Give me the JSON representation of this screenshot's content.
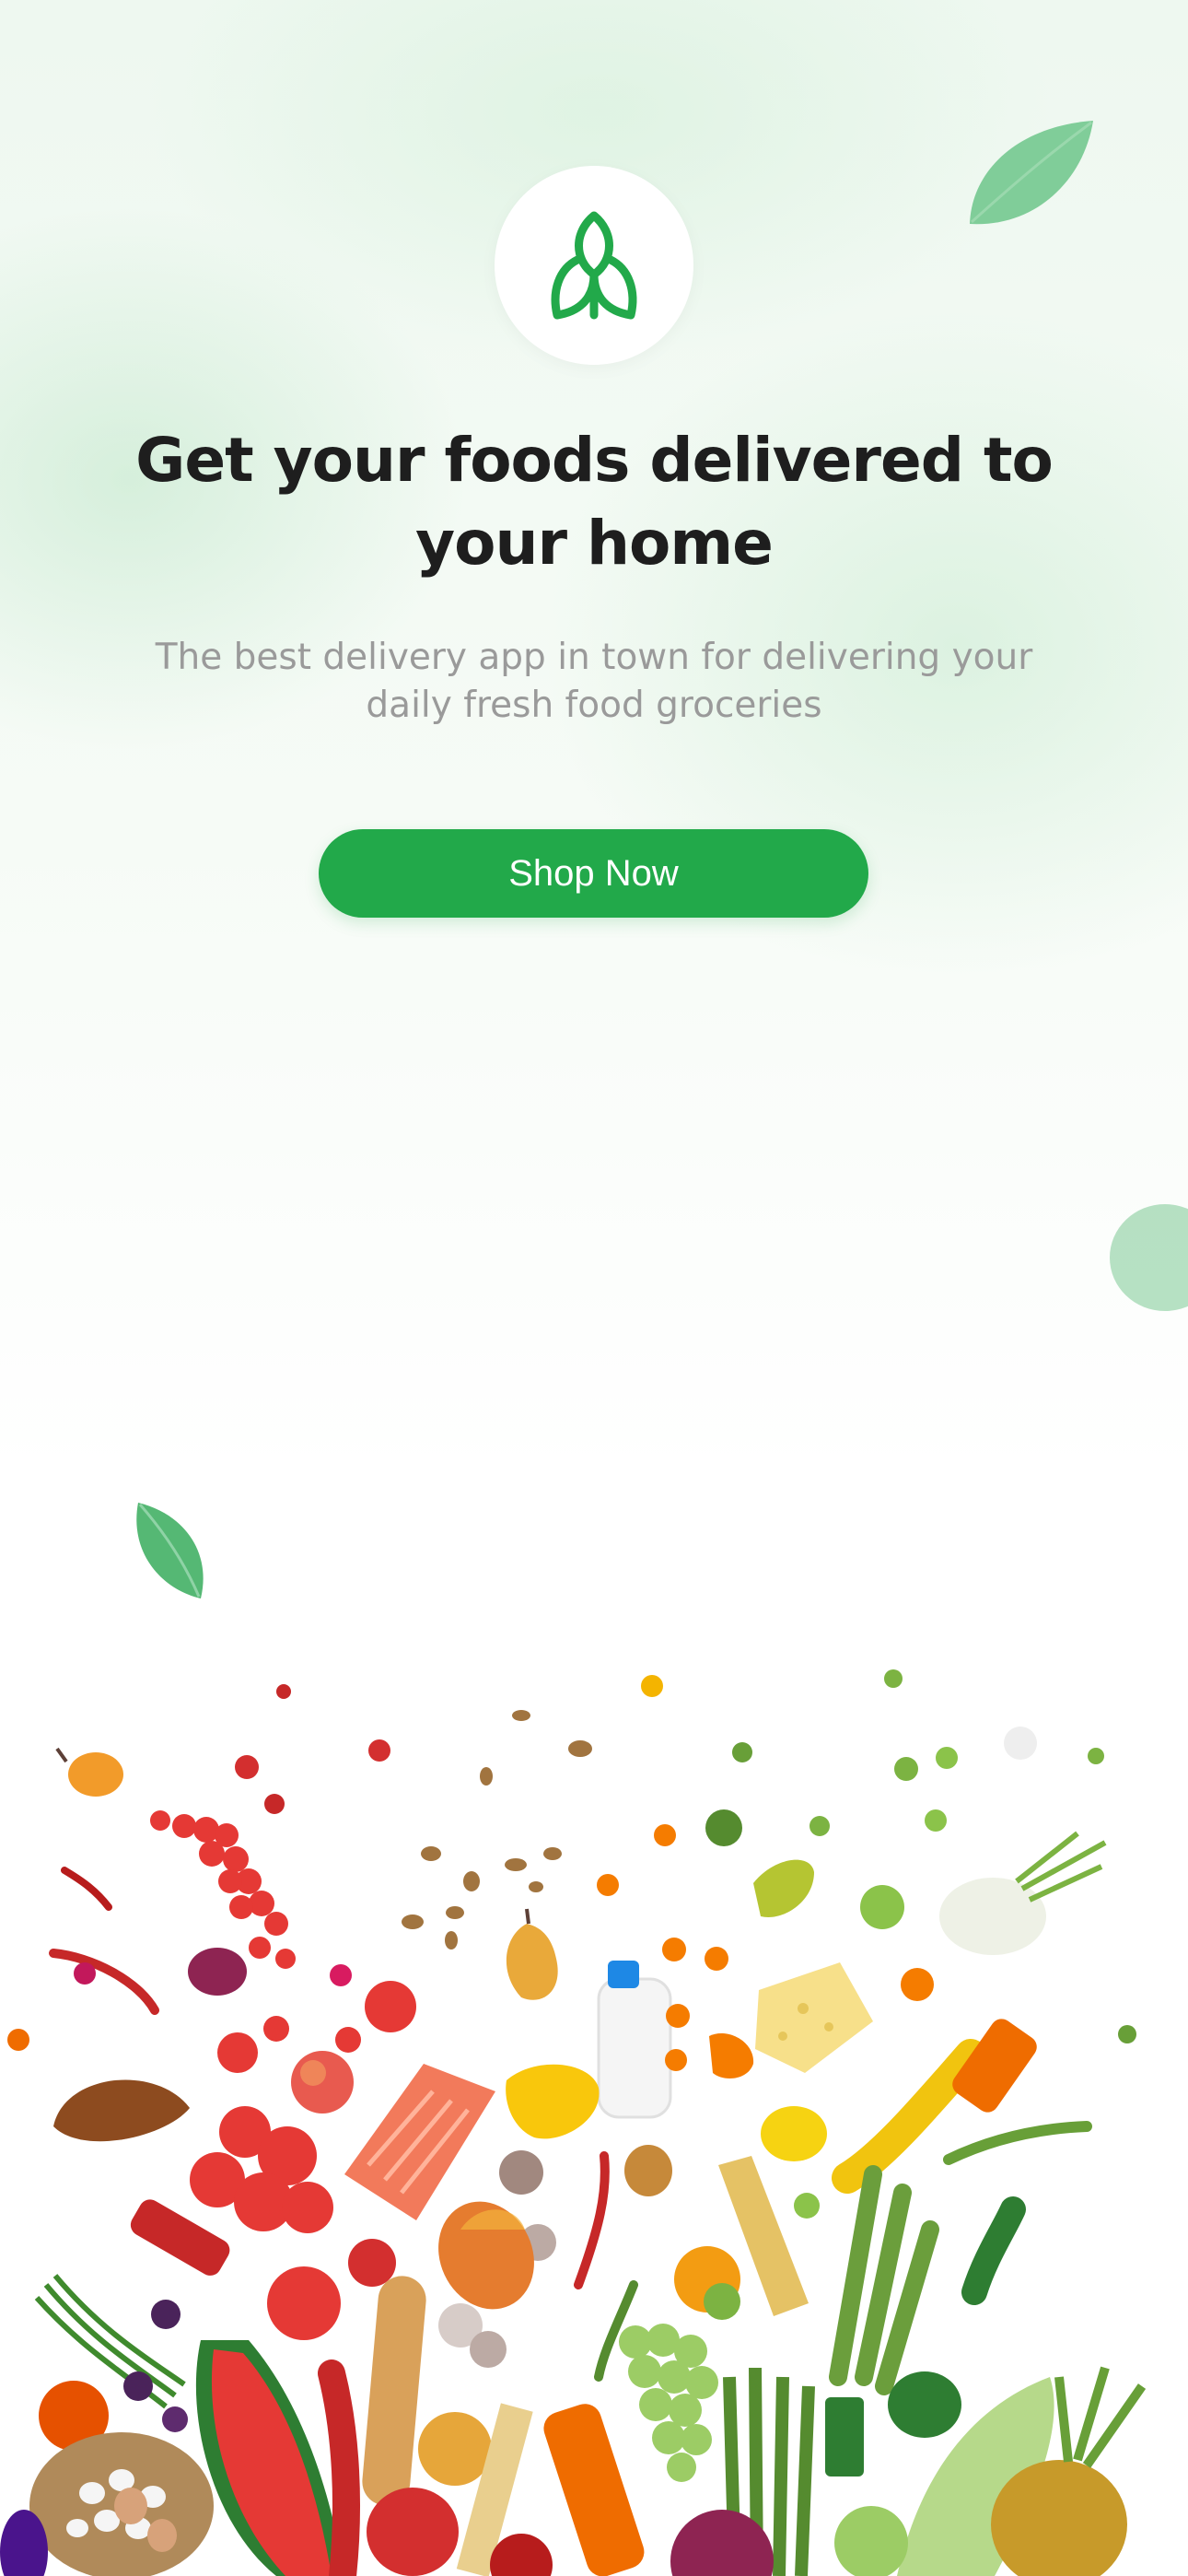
{
  "onboarding": {
    "logo_icon": "leaf-sprout-icon",
    "title": "Get your foods delivered to your home",
    "subtitle": "The best delivery app in town for delivering your daily fresh food groceries",
    "cta_label": "Shop Now"
  },
  "colors": {
    "brand_green": "#22a94a",
    "title": "#1e1e1e",
    "subtitle": "#9a9a9a"
  },
  "decoration": {
    "image": "fresh-produce-assortment",
    "leaves": [
      "leaf-icon",
      "leaf-icon",
      "leaf-icon"
    ]
  }
}
